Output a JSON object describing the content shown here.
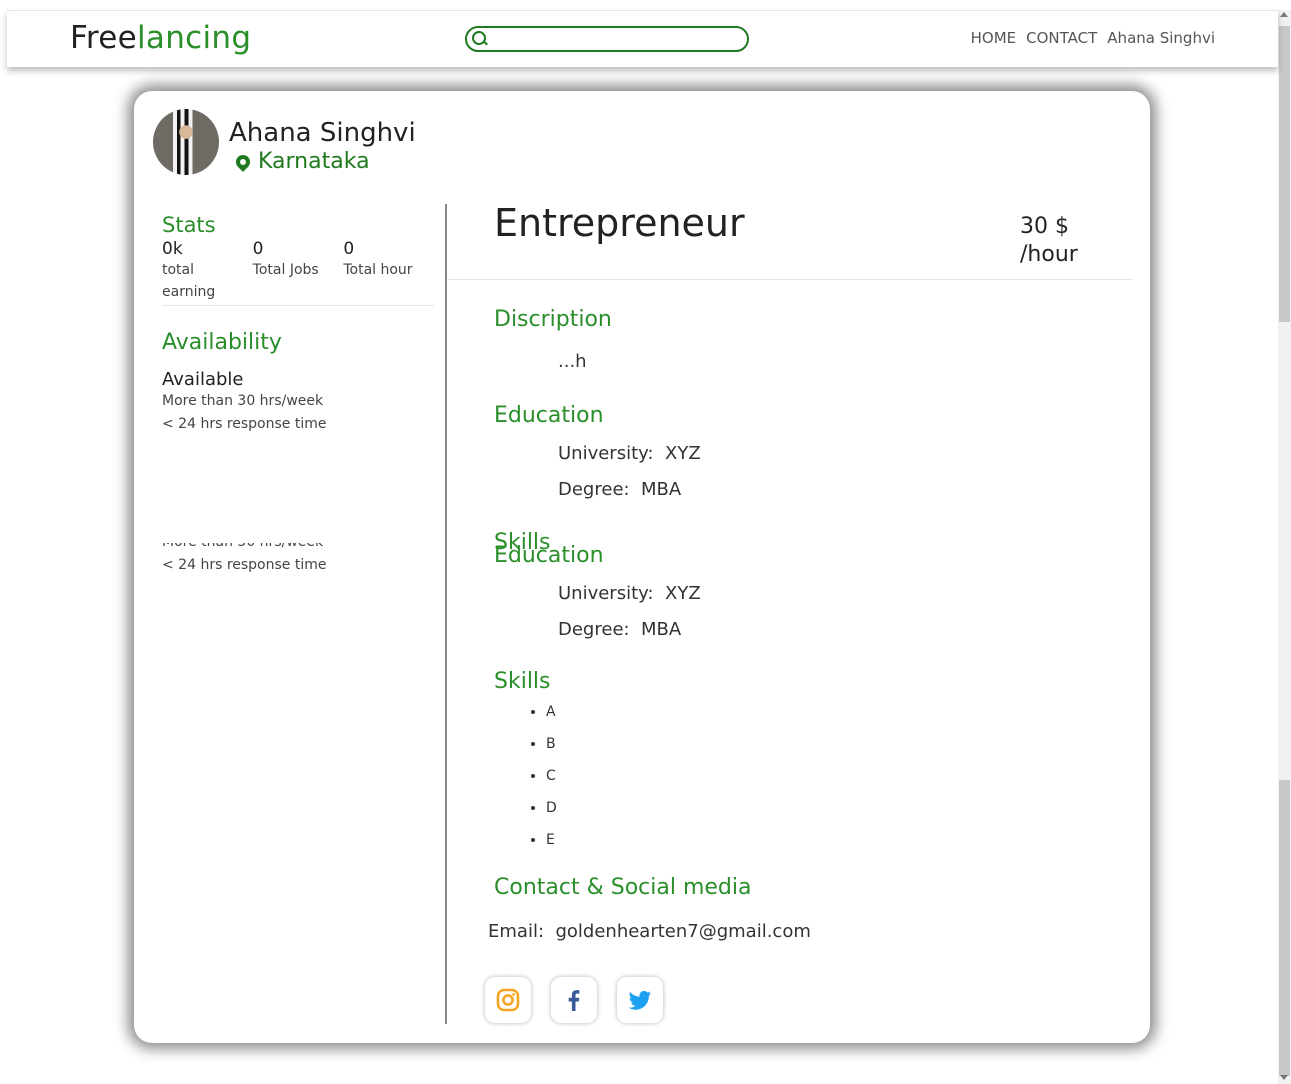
{
  "nav": {
    "brand_part1": "Free",
    "brand_part2": "lancing",
    "search_placeholder": "",
    "links": [
      "HOME",
      "CONTACT",
      "Ahana Singhvi"
    ]
  },
  "profile": {
    "name": "Ahana Singhvi",
    "location": "Karnataka",
    "title": "Entrepreneur",
    "rate_line1": "30 $",
    "rate_line2": "/hour"
  },
  "stats": {
    "heading": "Stats",
    "items": [
      {
        "value": "0k",
        "label": "total earning"
      },
      {
        "value": "0",
        "label": "Total Jobs"
      },
      {
        "value": "0",
        "label": "Total hour"
      }
    ]
  },
  "availability": {
    "heading": "Availability",
    "status": "Available",
    "hours": "More than 30 hrs/week",
    "response": "< 24 hrs response time"
  },
  "description": {
    "heading": "Discription",
    "text": "...h"
  },
  "education": {
    "heading": "Education",
    "university_label": "University:",
    "university_value": "XYZ",
    "degree_label": "Degree:",
    "degree_value": "MBA"
  },
  "skills": {
    "heading": "Skills",
    "items": [
      "A",
      "B",
      "C",
      "D",
      "E"
    ]
  },
  "contact": {
    "heading": "Contact & Social media",
    "email_label": "Email:",
    "email_value": "goldenhearten7@gmail.com"
  },
  "social": [
    {
      "icon": "instagram-icon",
      "color": "#f5a623"
    },
    {
      "icon": "facebook-icon",
      "color": "#3b5998"
    },
    {
      "icon": "twitter-icon",
      "color": "#1da1f2"
    }
  ]
}
